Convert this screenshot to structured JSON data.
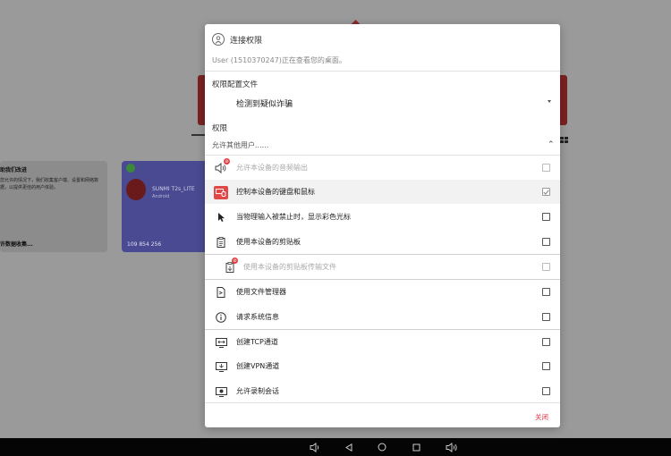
{
  "background": {
    "card1": {
      "title": "助我们改进",
      "desc": "您允许的情况下，我们收集客户端、设置和网络数据，以提供更佳的用户体验。",
      "footer": "许数据收集..."
    },
    "card2": {
      "name": "SUNMI T2s_LITE",
      "os": "Android",
      "id": "109 854 256"
    }
  },
  "dialog": {
    "title": "连接权限",
    "subtitle": "User (1510370247)正在查看您的桌面。",
    "profile_label": "权限配置文件",
    "profile_value": "检测到疑似诈骗",
    "permissions_label": "权限",
    "allow_others": "允许其他用户......",
    "permissions": [
      {
        "icon": "speaker-lock-icon",
        "label": "允许本设备的音频输出",
        "disabled": true,
        "checked": false
      },
      {
        "icon": "keyboard-mouse-icon",
        "label": "控制本设备的键盘和鼠标",
        "disabled": false,
        "checked": true
      },
      {
        "icon": "cursor-icon",
        "label": "当物理输入被禁止时，显示彩色光标",
        "disabled": false,
        "checked": false
      },
      {
        "icon": "clipboard-icon",
        "label": "使用本设备的剪贴板",
        "disabled": false,
        "checked": false
      },
      {
        "icon": "clipboard-file-lock-icon",
        "label": "使用本设备的剪贴板传输文件",
        "disabled": true,
        "checked": false
      },
      {
        "icon": "file-manager-icon",
        "label": "使用文件管理器",
        "disabled": false,
        "checked": false
      },
      {
        "icon": "info-icon",
        "label": "请求系统信息",
        "disabled": false,
        "checked": false
      },
      {
        "icon": "tcp-tunnel-icon",
        "label": "创建TCP通道",
        "disabled": false,
        "checked": false
      },
      {
        "icon": "vpn-tunnel-icon",
        "label": "创建VPN通道",
        "disabled": false,
        "checked": false
      },
      {
        "icon": "record-session-icon",
        "label": "允许录制会话",
        "disabled": false,
        "checked": false
      }
    ],
    "close_label": "关闭"
  },
  "navbar": {
    "items": [
      "volume-down-icon",
      "back-icon",
      "home-icon",
      "recents-icon",
      "volume-up-icon"
    ]
  }
}
